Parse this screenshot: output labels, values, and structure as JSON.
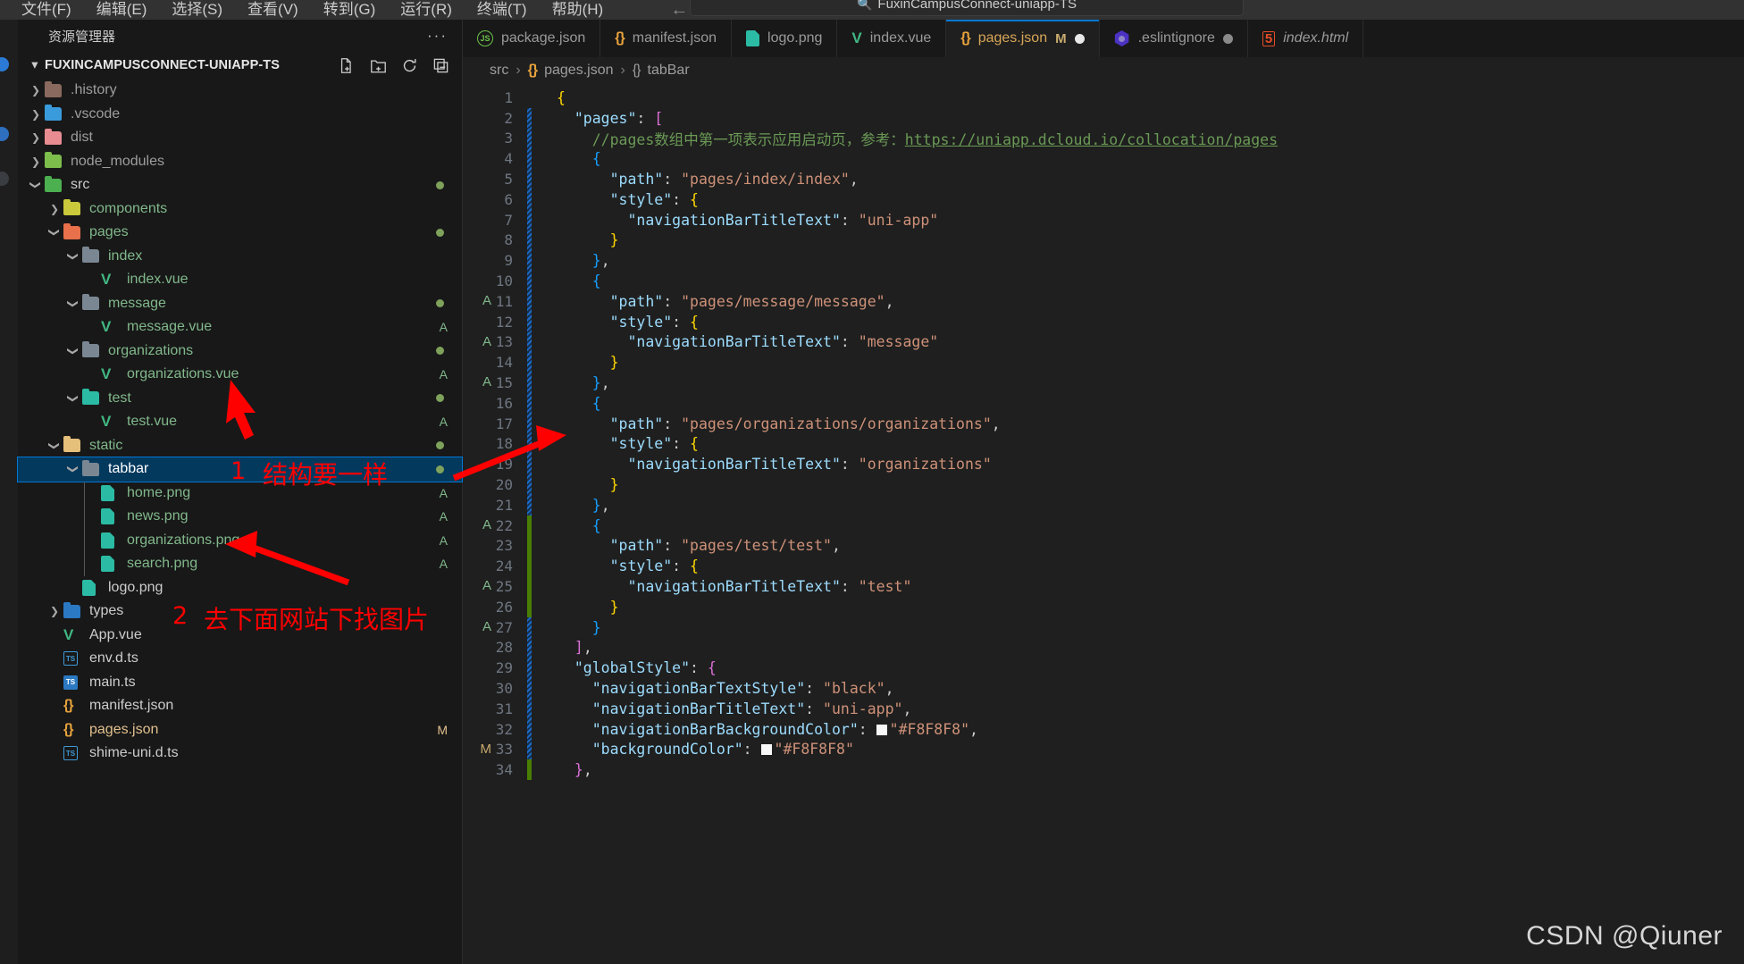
{
  "titlebar": {
    "menus": [
      "文件(F)",
      "编辑(E)",
      "选择(S)",
      "查看(V)",
      "转到(G)",
      "运行(R)",
      "终端(T)",
      "帮助(H)"
    ],
    "back_icon": "arrow-left-icon",
    "forward_icon": "arrow-right-icon",
    "search_icon": "search-icon",
    "search_value": "FuxinCampusConnect-uniapp-TS"
  },
  "sidebar": {
    "title": "资源管理器",
    "more_label": "···",
    "root": {
      "label": "FUXINCAMPUSCONNECT-UNIAPP-TS",
      "actions": [
        "new-file-icon",
        "new-folder-icon",
        "refresh-icon",
        "collapse-all-icon"
      ]
    },
    "tree": [
      {
        "label": ".history",
        "depth": 1,
        "type": "folder",
        "icon": "folder-history-icon",
        "arrow": "collapsed",
        "color": "#8a6a5e",
        "badge": "",
        "dot": false
      },
      {
        "label": ".vscode",
        "depth": 1,
        "type": "folder",
        "icon": "folder-vscode-icon",
        "arrow": "collapsed",
        "color": "#3a9bdc",
        "badge": "",
        "dot": false
      },
      {
        "label": "dist",
        "depth": 1,
        "type": "folder",
        "icon": "folder-dist-icon",
        "arrow": "collapsed",
        "color": "#e88c92",
        "badge": "",
        "dot": false
      },
      {
        "label": "node_modules",
        "depth": 1,
        "type": "folder",
        "icon": "folder-node-icon",
        "arrow": "collapsed",
        "color": "#7dbd4c",
        "badge": "",
        "dot": false
      },
      {
        "label": "src",
        "depth": 1,
        "type": "folder",
        "icon": "folder-src-icon",
        "arrow": "expanded",
        "color": "#4caf50",
        "badge": "",
        "dot": true
      },
      {
        "label": "components",
        "depth": 2,
        "type": "folder",
        "icon": "folder-components-icon",
        "arrow": "collapsed",
        "color": "#c9c93b",
        "badge": "",
        "dot": false
      },
      {
        "label": "pages",
        "depth": 2,
        "type": "folder",
        "icon": "folder-pages-icon",
        "arrow": "expanded",
        "color": "#e8704a",
        "badge": "",
        "dot": true
      },
      {
        "label": "index",
        "depth": 3,
        "type": "folder",
        "icon": "folder-icon",
        "arrow": "expanded",
        "color": "#7a8793",
        "badge": "",
        "dot": false
      },
      {
        "label": "index.vue",
        "depth": 4,
        "type": "vue",
        "icon": "vue-file-icon",
        "arrow": "none",
        "color": "",
        "badge": "",
        "dot": false
      },
      {
        "label": "message",
        "depth": 3,
        "type": "folder",
        "icon": "folder-icon",
        "arrow": "expanded",
        "color": "#7a8793",
        "badge": "",
        "dot": true
      },
      {
        "label": "message.vue",
        "depth": 4,
        "type": "vue",
        "icon": "vue-file-icon",
        "arrow": "none",
        "color": "",
        "badge": "A",
        "dot": false
      },
      {
        "label": "organizations",
        "depth": 3,
        "type": "folder",
        "icon": "folder-icon",
        "arrow": "expanded",
        "color": "#7a8793",
        "badge": "",
        "dot": true
      },
      {
        "label": "organizations.vue",
        "depth": 4,
        "type": "vue",
        "icon": "vue-file-icon",
        "arrow": "none",
        "color": "",
        "badge": "A",
        "dot": false
      },
      {
        "label": "test",
        "depth": 3,
        "type": "folder",
        "icon": "folder-test-icon",
        "arrow": "expanded",
        "color": "#2bbba4",
        "badge": "",
        "dot": true
      },
      {
        "label": "test.vue",
        "depth": 4,
        "type": "vue",
        "icon": "vue-file-icon",
        "arrow": "none",
        "color": "",
        "badge": "A",
        "dot": false
      },
      {
        "label": "static",
        "depth": 2,
        "type": "folder",
        "icon": "folder-static-icon",
        "arrow": "expanded",
        "color": "#e5c07b",
        "badge": "",
        "dot": true
      },
      {
        "label": "tabbar",
        "depth": 3,
        "type": "folder",
        "icon": "folder-icon",
        "arrow": "expanded",
        "color": "#7a8793",
        "badge": "",
        "dot": true,
        "selected": true
      },
      {
        "label": "home.png",
        "depth": 4,
        "type": "image",
        "icon": "image-file-icon",
        "arrow": "none",
        "color": "",
        "badge": "A",
        "dot": false
      },
      {
        "label": "news.png",
        "depth": 4,
        "type": "image",
        "icon": "image-file-icon",
        "arrow": "none",
        "color": "",
        "badge": "A",
        "dot": false
      },
      {
        "label": "organizations.png",
        "depth": 4,
        "type": "image",
        "icon": "image-file-icon",
        "arrow": "none",
        "color": "",
        "badge": "A",
        "dot": false
      },
      {
        "label": "search.png",
        "depth": 4,
        "type": "image",
        "icon": "image-file-icon",
        "arrow": "none",
        "color": "",
        "badge": "A",
        "dot": false
      },
      {
        "label": "logo.png",
        "depth": 3,
        "type": "image",
        "icon": "image-file-icon",
        "arrow": "none",
        "color": "",
        "badge": "",
        "dot": false
      },
      {
        "label": "types",
        "depth": 2,
        "type": "folder",
        "icon": "folder-types-icon",
        "arrow": "collapsed",
        "color": "#2b79c2",
        "badge": "",
        "dot": false
      },
      {
        "label": "App.vue",
        "depth": 2,
        "type": "vue",
        "icon": "vue-file-icon",
        "arrow": "none",
        "color": "",
        "badge": "",
        "dot": false
      },
      {
        "label": "env.d.ts",
        "depth": 2,
        "type": "ts-def",
        "icon": "typescript-def-icon",
        "arrow": "none",
        "color": "",
        "badge": "",
        "dot": false
      },
      {
        "label": "main.ts",
        "depth": 2,
        "type": "ts",
        "icon": "typescript-file-icon",
        "arrow": "none",
        "color": "",
        "badge": "",
        "dot": false
      },
      {
        "label": "manifest.json",
        "depth": 2,
        "type": "json",
        "icon": "json-file-icon",
        "arrow": "none",
        "color": "",
        "badge": "",
        "dot": false
      },
      {
        "label": "pages.json",
        "depth": 2,
        "type": "json",
        "icon": "json-file-icon",
        "arrow": "none",
        "color": "",
        "badge": "M",
        "dot": false
      },
      {
        "label": "shime-uni.d.ts",
        "depth": 2,
        "type": "ts-def",
        "icon": "typescript-def-icon",
        "arrow": "none",
        "color": "",
        "badge": "",
        "dot": false
      }
    ]
  },
  "editor": {
    "tabs": [
      {
        "label": "package.json",
        "icon": "js-file-icon",
        "active": false,
        "modified": "",
        "dirty": "none",
        "italic": false
      },
      {
        "label": "manifest.json",
        "icon": "json-file-icon",
        "active": false,
        "modified": "",
        "dirty": "none",
        "italic": false
      },
      {
        "label": "logo.png",
        "icon": "image-file-icon",
        "active": false,
        "modified": "",
        "dirty": "none",
        "italic": false
      },
      {
        "label": "index.vue",
        "icon": "vue-file-icon",
        "active": false,
        "modified": "",
        "dirty": "none",
        "italic": false
      },
      {
        "label": "pages.json",
        "icon": "json-file-icon",
        "active": true,
        "modified": "M",
        "dirty": "white",
        "italic": false
      },
      {
        "label": ".eslintignore",
        "icon": "eslint-file-icon",
        "active": false,
        "modified": "",
        "dirty": "gray",
        "italic": false
      },
      {
        "label": "index.html",
        "icon": "html-file-icon",
        "active": false,
        "modified": "",
        "dirty": "none",
        "italic": true
      }
    ],
    "breadcrumb": [
      "src",
      "pages.json",
      "tabBar"
    ],
    "code_lines": [
      {
        "n": 1,
        "change": "none",
        "html": "<span class='b1'>{</span>"
      },
      {
        "n": 2,
        "change": "blue",
        "html": "  <span class='k'>\"pages\"</span><span class='p'>:</span> <span class='b2'>[</span>"
      },
      {
        "n": 3,
        "change": "blue",
        "html": "    <span class='cm'>//pages数组中第一项表示应用启动页，参考：</span><span class='lnk'>https://uniapp.dcloud.io/collocation/pages</span>"
      },
      {
        "n": 4,
        "change": "blue",
        "html": "    <span class='b3'>{</span>"
      },
      {
        "n": 5,
        "change": "blue",
        "html": "      <span class='k'>\"path\"</span><span class='p'>:</span> <span class='s'>\"pages/index/index\"</span><span class='p'>,</span>"
      },
      {
        "n": 6,
        "change": "blue",
        "html": "      <span class='k'>\"style\"</span><span class='p'>:</span> <span class='b1'>{</span>"
      },
      {
        "n": 7,
        "change": "blue",
        "html": "        <span class='k'>\"navigationBarTitleText\"</span><span class='p'>:</span> <span class='s'>\"uni-app\"</span>"
      },
      {
        "n": 8,
        "change": "blue",
        "html": "      <span class='b1'>}</span>"
      },
      {
        "n": 9,
        "change": "blue",
        "html": "    <span class='b3'>}</span><span class='p'>,</span>"
      },
      {
        "n": 10,
        "change": "blue",
        "html": "    <span class='b3'>{</span>"
      },
      {
        "n": 11,
        "change": "blue",
        "html": "      <span class='k'>\"path\"</span><span class='p'>:</span> <span class='s'>\"pages/message/message\"</span><span class='p'>,</span>"
      },
      {
        "n": 12,
        "change": "blue",
        "html": "      <span class='k'>\"style\"</span><span class='p'>:</span> <span class='b1'>{</span>"
      },
      {
        "n": 13,
        "change": "blue",
        "html": "        <span class='k'>\"navigationBarTitleText\"</span><span class='p'>:</span> <span class='s'>\"message\"</span>"
      },
      {
        "n": 14,
        "change": "blue",
        "html": "      <span class='b1'>}</span>"
      },
      {
        "n": 15,
        "change": "blue",
        "html": "    <span class='b3'>}</span><span class='p'>,</span>"
      },
      {
        "n": 16,
        "change": "blue",
        "html": "    <span class='b3'>{</span>"
      },
      {
        "n": 17,
        "change": "blue",
        "html": "      <span class='k'>\"path\"</span><span class='p'>:</span> <span class='s'>\"pages/organizations/organizations\"</span><span class='p'>,</span>"
      },
      {
        "n": 18,
        "change": "blue",
        "html": "      <span class='k'>\"style\"</span><span class='p'>:</span> <span class='b1'>{</span>"
      },
      {
        "n": 19,
        "change": "blue",
        "html": "        <span class='k'>\"navigationBarTitleText\"</span><span class='p'>:</span> <span class='s'>\"organizations\"</span>"
      },
      {
        "n": 20,
        "change": "blue",
        "html": "      <span class='b1'>}</span>"
      },
      {
        "n": 21,
        "change": "blue",
        "html": "    <span class='b3'>}</span><span class='p'>,</span>"
      },
      {
        "n": 22,
        "change": "green",
        "html": "    <span class='b3'>{</span>"
      },
      {
        "n": 23,
        "change": "green",
        "html": "      <span class='k'>\"path\"</span><span class='p'>:</span> <span class='s'>\"pages/test/test\"</span><span class='p'>,</span>"
      },
      {
        "n": 24,
        "change": "green",
        "html": "      <span class='k'>\"style\"</span><span class='p'>:</span> <span class='b1'>{</span>"
      },
      {
        "n": 25,
        "change": "green",
        "html": "        <span class='k'>\"navigationBarTitleText\"</span><span class='p'>:</span> <span class='s'>\"test\"</span>"
      },
      {
        "n": 26,
        "change": "green",
        "html": "      <span class='b1'>}</span>"
      },
      {
        "n": 27,
        "change": "blue",
        "html": "    <span class='b3'>}</span>"
      },
      {
        "n": 28,
        "change": "blue",
        "html": "  <span class='b2'>]</span><span class='p'>,</span>"
      },
      {
        "n": 29,
        "change": "blue",
        "html": "  <span class='k'>\"globalStyle\"</span><span class='p'>:</span> <span class='b2'>{</span>"
      },
      {
        "n": 30,
        "change": "blue",
        "html": "    <span class='k'>\"navigationBarTextStyle\"</span><span class='p'>:</span> <span class='s'>\"black\"</span><span class='p'>,</span>"
      },
      {
        "n": 31,
        "change": "blue",
        "html": "    <span class='k'>\"navigationBarTitleText\"</span><span class='p'>:</span> <span class='s'>\"uni-app\"</span><span class='p'>,</span>"
      },
      {
        "n": 32,
        "change": "blue",
        "html": "    <span class='k'>\"navigationBarBackgroundColor\"</span><span class='p'>:</span> <span class='sw'></span><span class='s'>\"#F8F8F8\"</span><span class='p'>,</span>"
      },
      {
        "n": 33,
        "change": "blue",
        "html": "    <span class='k'>\"backgroundColor\"</span><span class='p'>:</span> <span class='sw'></span><span class='s'>\"#F8F8F8\"</span>"
      },
      {
        "n": 34,
        "change": "green",
        "html": "  <span class='b2'>}</span><span class='p'>,</span>"
      }
    ],
    "gutter_markers": [
      {
        "char": "A",
        "line": 11
      },
      {
        "char": "A",
        "line": 13
      },
      {
        "char": "A",
        "line": 15
      },
      {
        "char": "A",
        "line": 22
      },
      {
        "char": "A",
        "line": 25
      },
      {
        "char": "A",
        "line": 27
      },
      {
        "char": "M",
        "line": 33
      }
    ]
  },
  "annotations": {
    "note1_num": "1",
    "note1_text": "结构要一样",
    "note2_num": "2",
    "note2_text": "去下面网站下找图片",
    "arrow1_name": "arrow-to-organizations-vue",
    "arrow2_name": "arrow-tabbar-to-code",
    "arrow3_name": "arrow-to-organizations-png"
  },
  "watermark": "CSDN @Qiuner",
  "colors": {
    "accent": "#0078d4",
    "selection": "#04395e",
    "annotation": "#ff0000",
    "string": "#ce9178",
    "key": "#9cdcfe",
    "comment": "#6a9955"
  }
}
